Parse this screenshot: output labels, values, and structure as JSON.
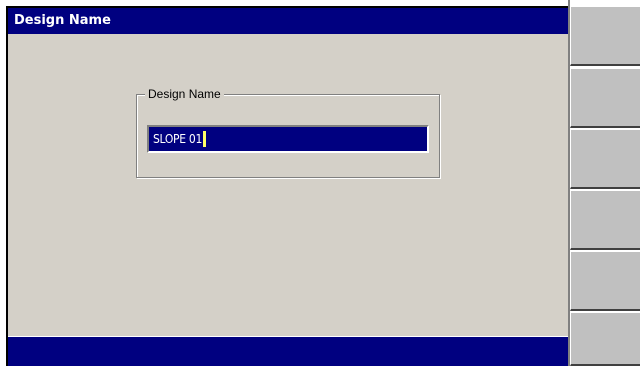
{
  "window": {
    "title": "Design Name"
  },
  "form": {
    "group_label": "Design Name",
    "name_value": "SLOPE 01"
  },
  "softkeys": [
    {
      "label": ""
    },
    {
      "label": ""
    },
    {
      "label": ""
    },
    {
      "label": ""
    },
    {
      "label": ""
    },
    {
      "label": ""
    }
  ],
  "colors": {
    "title_bar": "#000080",
    "background": "#d4d0c8",
    "input_background": "#000080",
    "caret": "#ffff66"
  }
}
